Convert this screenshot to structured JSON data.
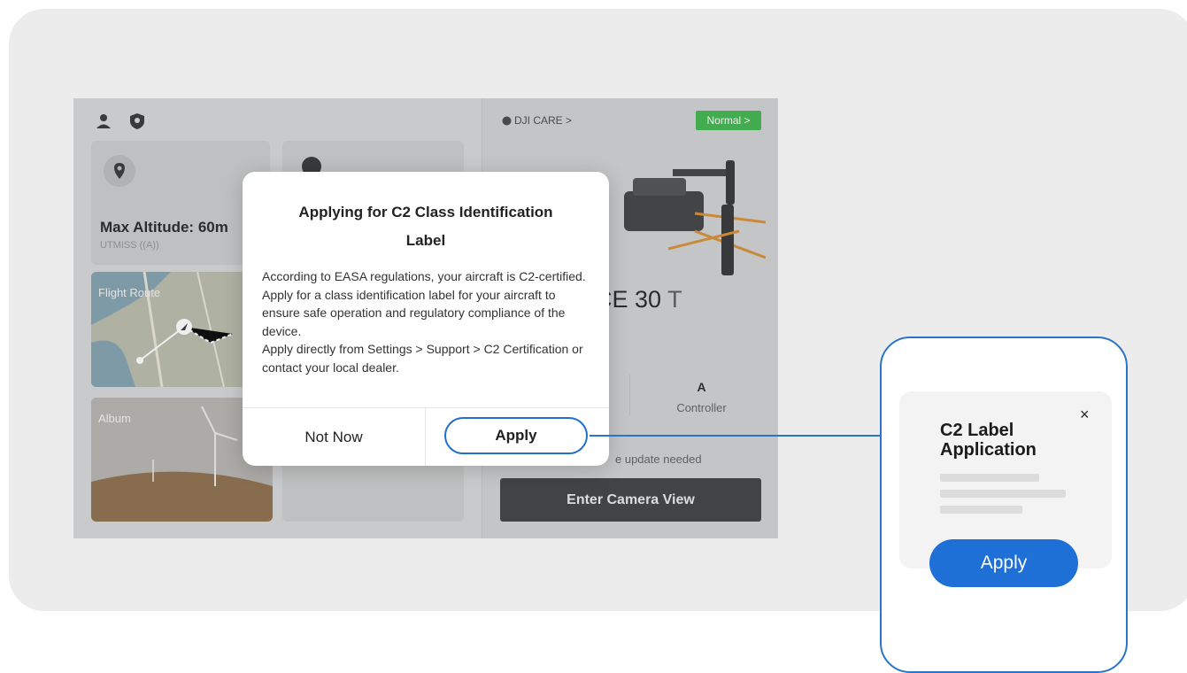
{
  "left_panel": {
    "location_card": {
      "title": "Max Altitude: 60m",
      "subtitle": "UTMISS ((A))"
    },
    "flight_route": {
      "label": "Flight Route"
    },
    "album": {
      "label": "Album"
    }
  },
  "right_panel": {
    "care_label": "DJI CARE >",
    "status_badge": "Normal >",
    "model_name": "RICE 30",
    "model_suffix": "T",
    "controller_value": "A",
    "controller_label": "Controller",
    "update_text": "e update needed",
    "camera_button": "Enter Camera View"
  },
  "dialog": {
    "title": "Applying for C2 Class Identification Label",
    "body_line1": "According to EASA regulations, your aircraft is C2-certified. Apply for a class identification label for your aircraft to ensure safe operation and regulatory compliance of the device.",
    "body_line2": "Apply directly from Settings > Support > C2 Certification or contact your local dealer.",
    "not_now": "Not Now",
    "apply": "Apply"
  },
  "callout": {
    "title": "C2 Label Application",
    "close": "×",
    "apply": "Apply"
  },
  "colors": {
    "accent": "#1e6fd6",
    "status_green": "#3cb34a",
    "camera_button": "#3a3c3e"
  }
}
